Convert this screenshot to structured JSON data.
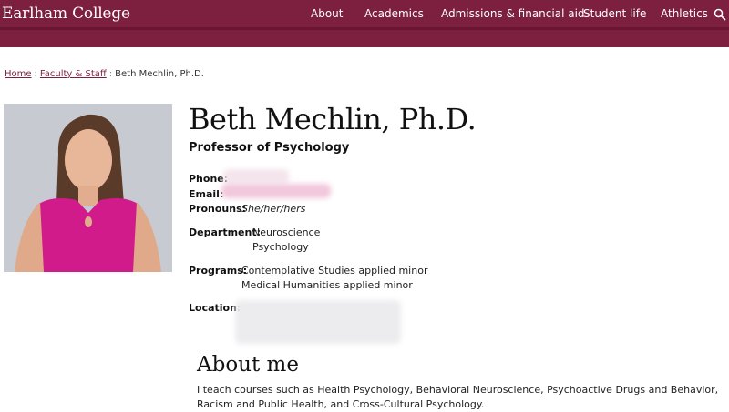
{
  "header": {
    "logo": "Earlham College",
    "nav": [
      "About",
      "Academics",
      "Admissions & financial aid",
      "Student life",
      "Athletics"
    ],
    "search_icon": "search-icon"
  },
  "breadcrumb": {
    "home": "Home",
    "sep": ":",
    "faculty": "Faculty & Staff",
    "current": "Beth Mechlin, Ph.D."
  },
  "profile": {
    "name": "Beth Mechlin, Ph.D.",
    "role": "Professor of Psychology",
    "phone_label": "Phone:",
    "email_label": "Email:",
    "pronouns_label": "Pronouns:",
    "pronouns": "She/her/hers",
    "department_label": "Department:",
    "departments": [
      "Neuroscience",
      "Psychology"
    ],
    "programs_label": "Programs:",
    "programs": [
      "Contemplative Studies applied minor",
      "Medical Humanities applied minor"
    ],
    "location_label": "Location:"
  },
  "about": {
    "heading": "About me",
    "text": "I teach courses such as Health Psychology, Behavioral Neuroscience, Psychoactive Drugs and Behavior, Racism and Public Health, and Cross-Cultural Psychology."
  },
  "colors": {
    "brand": "#7d1f3f",
    "brand_dark": "#6a1633"
  }
}
